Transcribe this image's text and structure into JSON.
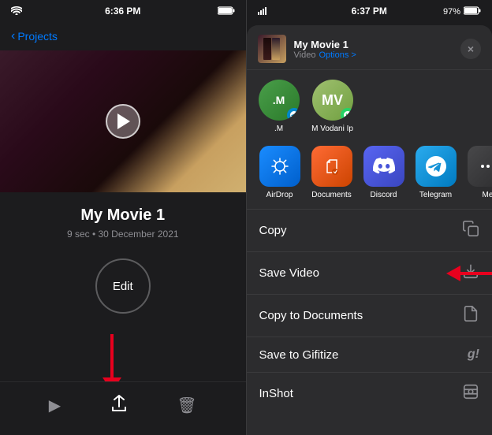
{
  "leftPanel": {
    "statusBar": {
      "time": "6:36 PM",
      "battery": "100%"
    },
    "nav": {
      "backLabel": "Projects"
    },
    "movie": {
      "title": "My Movie 1",
      "meta": "9 sec • 30 December 2021"
    },
    "editButton": "Edit",
    "toolbar": {
      "playLabel": "▶",
      "shareLabel": "⬆",
      "deleteLabel": "🗑"
    }
  },
  "rightPanel": {
    "statusBar": {
      "time": "6:37 PM",
      "battery": "97%"
    },
    "shareSheet": {
      "title": "My Movie 1",
      "subtitle": "Video",
      "optionsLabel": "Options >",
      "closeLabel": "×"
    },
    "contacts": [
      {
        "name": ".M",
        "initials": ".M",
        "badge": "telegram"
      },
      {
        "name": "M Vodani Ip",
        "initials": "MV",
        "badge": "whatsapp"
      }
    ],
    "apps": [
      {
        "label": "AirDrop",
        "type": "airdrop"
      },
      {
        "label": "Documents",
        "type": "documents"
      },
      {
        "label": "Discord",
        "type": "discord"
      },
      {
        "label": "Telegram",
        "type": "telegram"
      },
      {
        "label": "Me",
        "type": "more"
      }
    ],
    "actions": [
      {
        "label": "Copy",
        "icon": "copy"
      },
      {
        "label": "Save Video",
        "icon": "download"
      },
      {
        "label": "Copy to Documents",
        "icon": "documents"
      },
      {
        "label": "Save to Gifitize",
        "icon": "gif"
      },
      {
        "label": "InShot",
        "icon": "camera"
      }
    ]
  }
}
